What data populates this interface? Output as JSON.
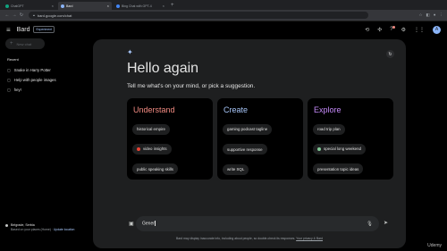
{
  "browser": {
    "tabs": [
      {
        "label": "ChatGPT",
        "favicon_color": "#10a37f",
        "active": false
      },
      {
        "label": "Bard",
        "favicon_color": "#8ab4f8",
        "active": true
      },
      {
        "label": "Bing Chat with GPT-4",
        "favicon_color": "#4285f4",
        "active": false
      }
    ],
    "new_tab": "+",
    "url": "bard.google.com/chat"
  },
  "header": {
    "brand": "Bard",
    "badge": "Experiment",
    "avatar_letter": "A"
  },
  "sidebar": {
    "new_chat": "New chat",
    "recent_heading": "Recent",
    "recent": [
      {
        "label": "Snake in Harry Potter"
      },
      {
        "label": "Help with people images"
      },
      {
        "label": "hey!"
      }
    ],
    "location_title": "Belgrade, Serbia",
    "location_sub": "Based on your places (Home) · ",
    "location_update": "Update location"
  },
  "main": {
    "greeting": "Hello again",
    "subtitle": "Tell me what's on your mind, or pick a suggestion.",
    "cards": [
      {
        "title": "Understand",
        "color": "#f28b82",
        "chips": [
          {
            "label": "historical empire",
            "icon": ""
          },
          {
            "label": "video insights",
            "icon": "#ea4335"
          },
          {
            "label": "public speaking skills",
            "icon": ""
          }
        ]
      },
      {
        "title": "Create",
        "color": "#a8c7fa",
        "chips": [
          {
            "label": "gaming podcast tagline",
            "icon": ""
          },
          {
            "label": "supportive response",
            "icon": ""
          },
          {
            "label": "write SQL",
            "icon": ""
          }
        ]
      },
      {
        "title": "Explore",
        "color": "#c58af9",
        "chips": [
          {
            "label": "road trip plan",
            "icon": ""
          },
          {
            "label": "special long weekend",
            "icon": "#81c995"
          },
          {
            "label": "presentation topic ideas",
            "icon": ""
          }
        ]
      }
    ],
    "prompt_value": "Gener",
    "disclaimer": "Bard may display inaccurate info, including about people, so double-check its responses.",
    "disclaimer_link": "Your privacy & Bard"
  },
  "watermark": "Udemy"
}
